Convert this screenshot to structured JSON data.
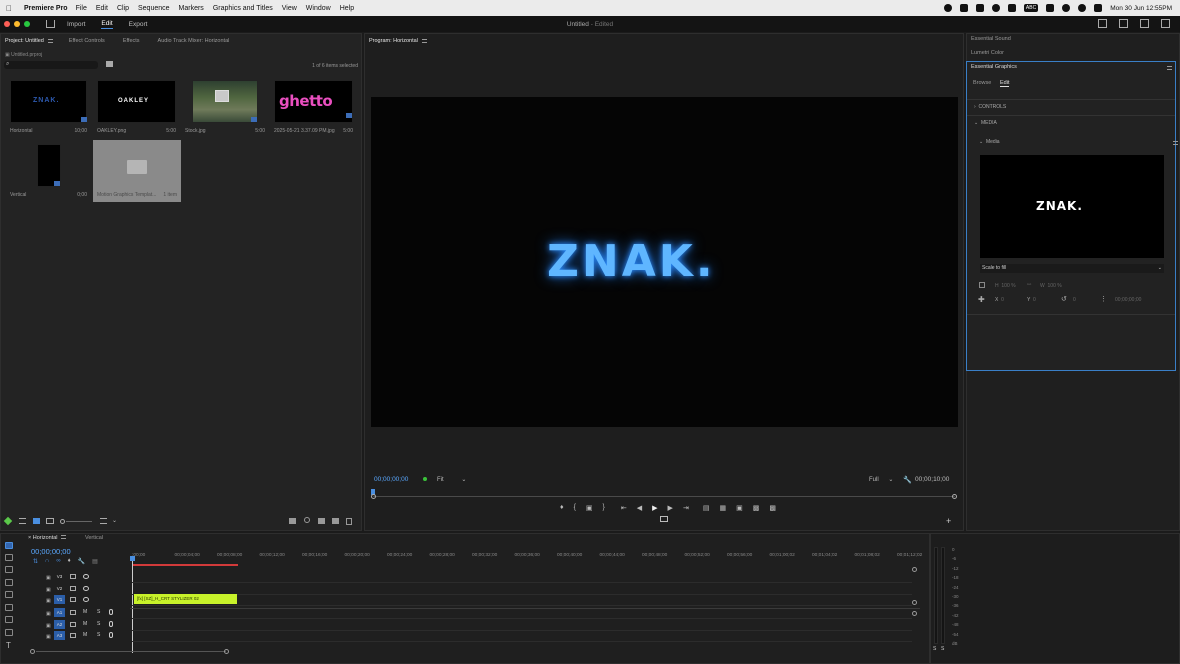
{
  "menubar": {
    "app": "Premiere Pro",
    "items": [
      "File",
      "Edit",
      "Clip",
      "Sequence",
      "Markers",
      "Graphics and Titles",
      "View",
      "Window",
      "Help"
    ],
    "input_source": "ABC",
    "clock": "Mon 30 Jun  12:55PM"
  },
  "header": {
    "import": "Import",
    "edit": "Edit",
    "export": "Export",
    "title": "Untitled",
    "status": "- Edited"
  },
  "project": {
    "tabs": [
      "Project: Untitled",
      "Effect Controls",
      "Effects",
      "Audio Track Mixer: Horizontal"
    ],
    "file": "Untitled.prproj",
    "selected": "1 of 6 items selected",
    "items": [
      {
        "name": "Horizontal",
        "duration": "10;00"
      },
      {
        "name": "OAKLEY.png",
        "duration": "5:00"
      },
      {
        "name": "Stock.jpg",
        "duration": "5:00"
      },
      {
        "name": "2025-05-21 3.37.09 PM.jpg",
        "duration": "5:00"
      },
      {
        "name": "Vertical",
        "duration": "0;00"
      },
      {
        "name": "Motion Graphics Templat...",
        "duration": "1 item"
      }
    ],
    "thumb_text": {
      "znak": "ZNAK.",
      "oakley": "OAKLEY",
      "ghetto": "ghetto"
    }
  },
  "program": {
    "title": "Program: Horizontal",
    "screen_text": "ZNAK.",
    "timecode": "00;00;00;00",
    "fit": "Fit",
    "quality": "Full",
    "duration": "00;00;10;00"
  },
  "right": {
    "essential_sound": "Essential Sound",
    "lumetri": "Lumetri Color",
    "eg_title": "Essential Graphics",
    "tab_browse": "Browse",
    "tab_edit": "Edit",
    "controls": "CONTROLS",
    "media": "MEDIA",
    "media_sub": "Media",
    "preview_text": "ZNAK.",
    "scale": "Scale to fill",
    "h_label": "H",
    "h_val": "100 %",
    "w_label": "W",
    "w_val": "100 %",
    "x_label": "X",
    "x_val": "0",
    "y_label": "Y",
    "y_val": "0",
    "rot_val": "0",
    "tc": "00;00;00;00"
  },
  "timeline": {
    "tabs": [
      "Horizontal",
      "Vertical"
    ],
    "timecode": "00;00;00;00",
    "ruler": [
      ":00;00",
      "00;00;04;00",
      "00;00;08;00",
      "00;00;12;00",
      "00;00;16;00",
      "00;00;20;00",
      "00;00;24;00",
      "00;00;28;00",
      "00;00;32;00",
      "00;00;36;00",
      "00;00;40;00",
      "00;00;44;00",
      "00;00;48;00",
      "00;00;52;00",
      "00;00;56;00",
      "00;01;00;02",
      "00;01;04;02",
      "00;01;08;02",
      "00;01;12;02"
    ],
    "tracks": [
      "V3",
      "V2",
      "V1",
      "A1",
      "A2",
      "A3"
    ],
    "clip": "[fx]  [SZ]_H_CRT STYLIZER 02",
    "m": "M",
    "s": "S"
  },
  "meters": {
    "scale": [
      "0",
      "-6",
      "-12",
      "-18",
      "-24",
      "-30",
      "-36",
      "-42",
      "-48",
      "-54",
      "dB"
    ],
    "s_label": "S"
  }
}
